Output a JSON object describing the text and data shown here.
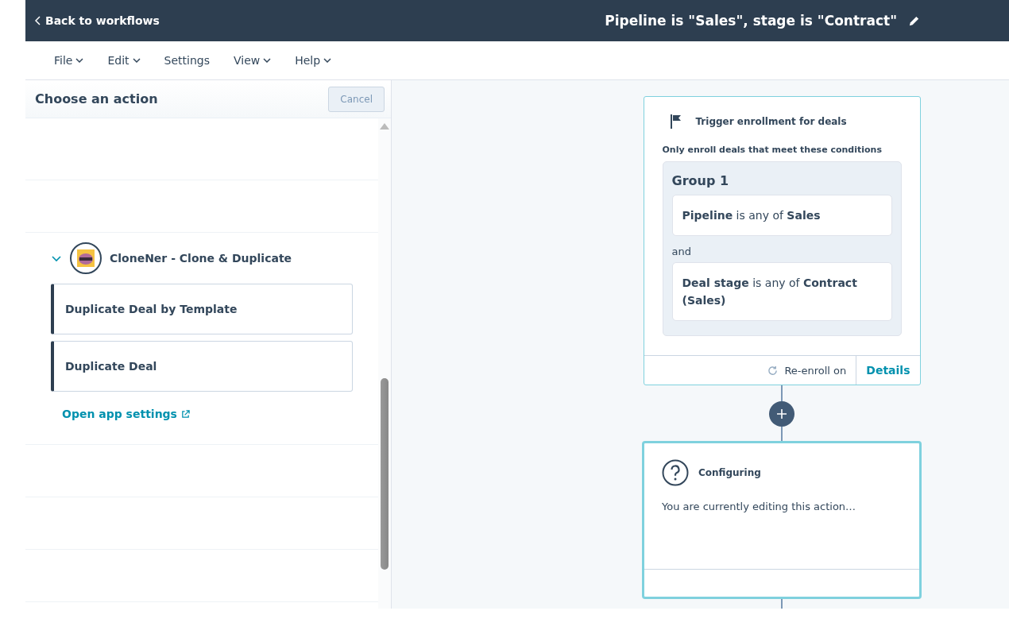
{
  "header": {
    "back_link": "Back to workflows",
    "title": "Pipeline is \"Sales\", stage is \"Contract\""
  },
  "menu": [
    {
      "label": "File",
      "has_dropdown": true
    },
    {
      "label": "Edit",
      "has_dropdown": true
    },
    {
      "label": "Settings",
      "has_dropdown": false
    },
    {
      "label": "View",
      "has_dropdown": true
    },
    {
      "label": "Help",
      "has_dropdown": true
    }
  ],
  "panel": {
    "title": "Choose an action",
    "cancel": "Cancel",
    "app": {
      "name": "CloneNer - Clone & Duplicate",
      "expanded": true,
      "actions": [
        "Duplicate Deal by Template",
        "Duplicate Deal"
      ],
      "settings_link": "Open app settings"
    }
  },
  "trigger": {
    "title": "Trigger enrollment for deals",
    "subtitle": "Only enroll deals that meet these conditions",
    "group": "Group 1",
    "conditions": [
      "**Pipeline** is any of **Sales**",
      "**Deal stage** is any of **Contract (Sales)**"
    ],
    "joiner": "and",
    "reenroll": "Re-enroll on",
    "details": "Details"
  },
  "action_card": {
    "title": "Configuring",
    "body": "You are currently editing this action…"
  }
}
